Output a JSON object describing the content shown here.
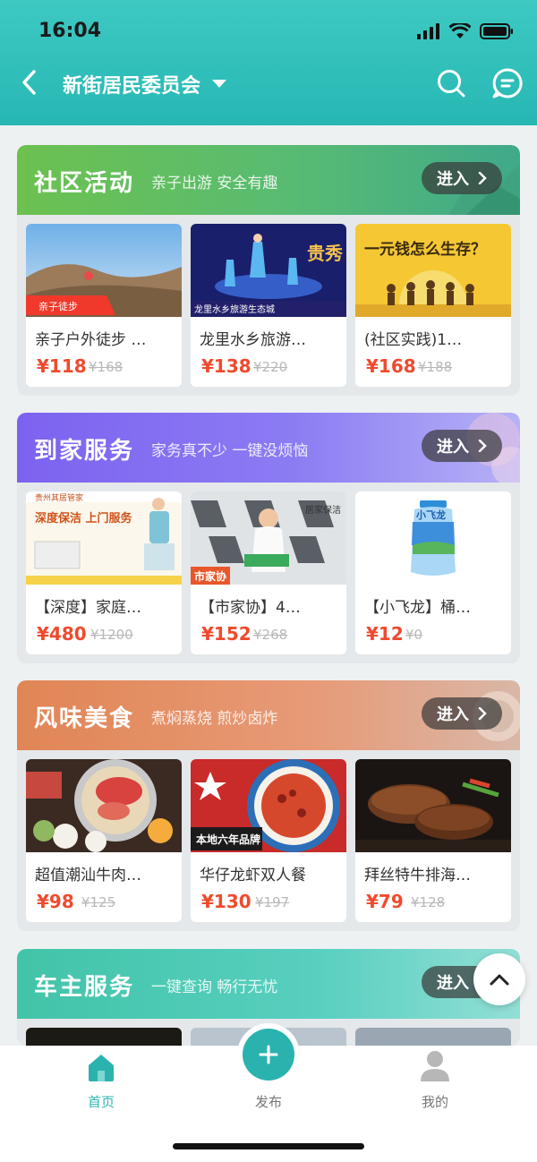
{
  "status_bar": {
    "time": "16:04"
  },
  "nav": {
    "title": "新街居民委员会"
  },
  "sections": [
    {
      "title": "社区活动",
      "subtitle": "亲子出游 安全有趣",
      "enter_label": "进入",
      "color": "#5cbb6a",
      "items": [
        {
          "title": "亲子户外徒步 …",
          "price": "¥118",
          "original_price": "¥168",
          "tag": "亲子徒步"
        },
        {
          "title": "龙里水乡旅游…",
          "price": "¥138",
          "original_price": "¥220",
          "tag": "龙里水乡旅游生态城",
          "sign": "贵秀"
        },
        {
          "title": "(社区实践)1…",
          "price": "¥168",
          "original_price": "¥188",
          "banner": "一元钱怎么生存？"
        }
      ]
    },
    {
      "title": "到家服务",
      "subtitle": "家务真不少 一键没烦恼",
      "enter_label": "进入",
      "color": "#7b6cf2",
      "items": [
        {
          "title": "【深度】家庭…",
          "price": "¥480",
          "original_price": "¥1200",
          "tag": "贵州其居管家",
          "banner": "深度保洁 上门服务"
        },
        {
          "title": "【市家协】4…",
          "price": "¥152",
          "original_price": "¥268",
          "tag": "市家协",
          "banner": "居家保洁"
        },
        {
          "title": "【小飞龙】桶…",
          "price": "¥12",
          "original_price": "¥0",
          "banner": "小飞龙"
        }
      ]
    },
    {
      "title": "风味美食",
      "subtitle": "煮焖蒸烧 煎炒卤炸",
      "enter_label": "进入",
      "color": "#e08a5a",
      "items": [
        {
          "title": "超值潮汕牛肉…",
          "price": "¥98",
          "original_price": "¥125"
        },
        {
          "title": "华仔龙虾双人餐",
          "price": "¥130",
          "original_price": "¥197",
          "banner": "本地六年品牌"
        },
        {
          "title": "拜丝特牛排海…",
          "price": "¥79",
          "original_price": "¥128"
        }
      ]
    },
    {
      "title": "车主服务",
      "subtitle": "一键查询 畅行无忧",
      "enter_label": "进入",
      "color": "#4ccab8"
    }
  ],
  "tab_bar": {
    "home": "首页",
    "publish": "发布",
    "mine": "我的"
  },
  "colors": {
    "accent": "#2ab3ae",
    "price": "#f04a2d"
  }
}
